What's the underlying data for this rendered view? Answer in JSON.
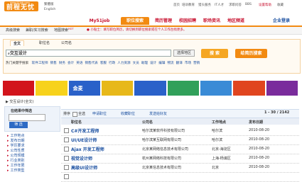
{
  "header": {
    "logo_text": "前程无忧",
    "logo_url": "www.51job.com",
    "lang_zh": "繁體版",
    "lang_en": "English",
    "top_links": [
      "首页",
      "培训教育",
      "猎头服务",
      "IT人才",
      "求职问答",
      "BBS",
      "设置帮助",
      "收藏"
    ]
  },
  "nav": {
    "items": [
      "My51job",
      "职位搜索",
      "简历管理",
      "校园招聘",
      "职场资讯",
      "地区频道",
      "企业登录"
    ],
    "active_index": 1
  },
  "subnav": {
    "items": [
      "高级搜索",
      "兼职/实习搜索",
      "地图搜索",
      "HOT"
    ],
    "notice": "● 小贴士：填写职位简历，请切换到职位搜索或在个人工作台找更多。"
  },
  "search": {
    "tabs": [
      "全文",
      "职位名",
      "公司名"
    ],
    "active_tab": 0,
    "query": "交互设计",
    "area_label": "选择地区",
    "search_label": "搜 索",
    "resume_label": "给简历搜索",
    "hot_label": "热门关键字搜索",
    "hot_keywords": [
      "软件工程师",
      "销售",
      "财务",
      "会计",
      "英语",
      "销售代表",
      "客服",
      "行政",
      "人力资源",
      "文员",
      "助理",
      "设计",
      "编辑",
      "物流",
      "翻译",
      "市场",
      "营销"
    ]
  },
  "ads": {
    "colors": [
      "#d2141b",
      "#f7d21b",
      "#2a61c9",
      "#e7b81a",
      "#2a61c9",
      "#31a05a",
      "#3a8bd6",
      "#e0451f",
      "#7a2c9c"
    ],
    "labels": [
      "",
      "",
      "金麦",
      "",
      "",
      "",
      "",
      "",
      ""
    ]
  },
  "results": {
    "crumb": "▶ 交互设计(全文)",
    "filter_title": "在结果中筛选",
    "filter_button": "筛 选",
    "tree": [
      "工作地点",
      "发布日期",
      "学历要求",
      "公司性质",
      "公司规模",
      "行业类别",
      "工作年限",
      "工作类型"
    ],
    "toolbar": [
      "全选",
      "申请职位",
      "收藏职位",
      "发送给好友"
    ],
    "pager": "1 - 30 / 2142",
    "columns": [
      "职位名",
      "公司名",
      "工作地点",
      "发布日期"
    ],
    "rows": [
      {
        "job": "C#开发工程师",
        "company": "哈尔滨某软件科技有限公司",
        "location": "哈尔滨",
        "date": "2010-08-20"
      },
      {
        "job": "UI/UE设计师",
        "company": "哈尔滨某互联网有限公司",
        "location": "哈尔滨",
        "date": "2010-08-20"
      },
      {
        "job": "Ajax 开发工程师",
        "company": "北京某网络信息技术有限公司",
        "location": "北京-海淀区",
        "date": "2010-08-20"
      },
      {
        "job": "视觉设计师",
        "company": "杭州某网络科技有限公司",
        "location": "上海-杨浦区",
        "date": "2010-08-20"
      },
      {
        "job": "高级UI设计师",
        "company": "北京某信息技术有限公司",
        "location": "北京",
        "date": "2010-08-20"
      },
      {
        "job": "",
        "company": "",
        "location": "",
        "date": ""
      }
    ]
  },
  "colors": {
    "accent": "#f28a11",
    "link": "#1a4fa0",
    "brand_red": "#c8102e"
  }
}
